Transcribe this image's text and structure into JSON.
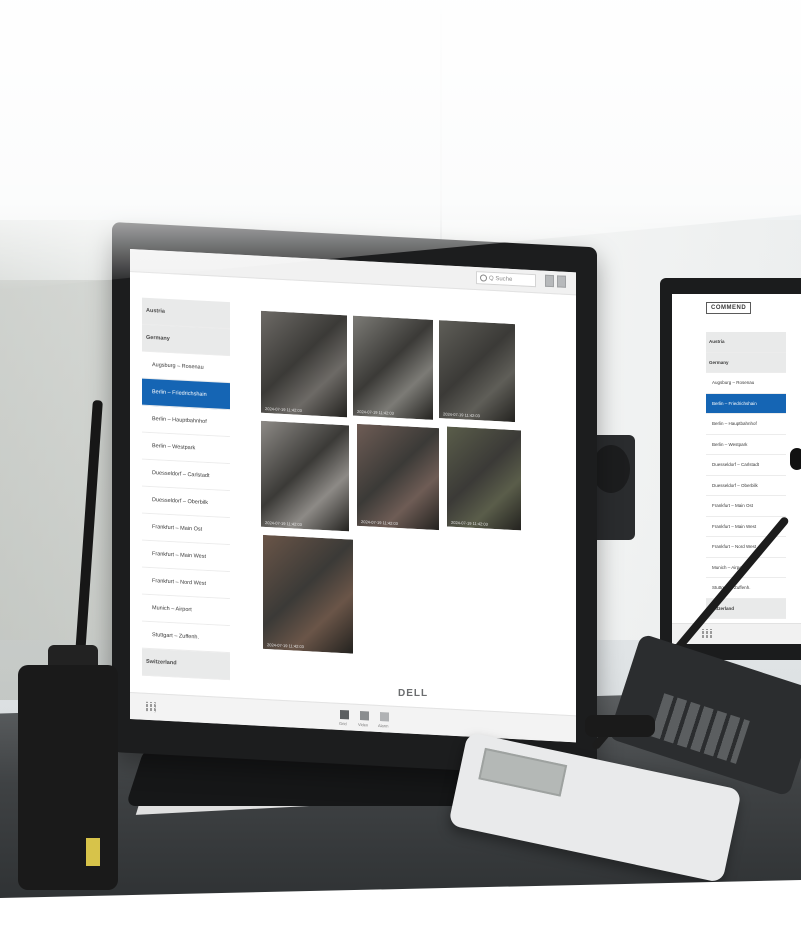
{
  "main_monitor": {
    "brand": "DELL",
    "search_placeholder": "Q Suche",
    "sidebar": [
      {
        "label": "Austria",
        "type": "country"
      },
      {
        "label": "Germany",
        "type": "country"
      },
      {
        "label": "Augsburg – Rosenau",
        "type": "item"
      },
      {
        "label": "Berlin – Friedrichshain",
        "type": "item",
        "active": true
      },
      {
        "label": "Berlin – Hauptbahnhof",
        "type": "item"
      },
      {
        "label": "Berlin – Westpark",
        "type": "item"
      },
      {
        "label": "Duesseldorf – Carlstadt",
        "type": "item"
      },
      {
        "label": "Duesseldorf – Oberbilk",
        "type": "item"
      },
      {
        "label": "Frankfurt – Main Ost",
        "type": "item"
      },
      {
        "label": "Frankfurt – Main West",
        "type": "item"
      },
      {
        "label": "Frankfurt – Nord West",
        "type": "item"
      },
      {
        "label": "Munich – Airport",
        "type": "item"
      },
      {
        "label": "Stuttgart – Zuffenh.",
        "type": "item"
      },
      {
        "label": "Switzerland",
        "type": "country"
      }
    ],
    "cameras": [
      {
        "timestamp": "2024-07-19 11:42:03",
        "palette": "#6d6a66"
      },
      {
        "timestamp": "2024-07-19 11:42:03",
        "palette": "#7c7b76"
      },
      {
        "timestamp": "2024-07-19 11:42:03",
        "palette": "#5f5e58"
      },
      {
        "timestamp": "2024-07-19 11:42:03",
        "palette": "#8d8a86"
      },
      {
        "timestamp": "2024-07-19 11:42:03",
        "palette": "#6e5c55"
      },
      {
        "timestamp": "2024-07-19 11:42:03",
        "palette": "#5a5d4a"
      },
      {
        "timestamp": "2024-07-19 11:42:03",
        "palette": "#6a5548"
      }
    ],
    "bottom_buttons": [
      "Grid",
      "Video",
      "Alarm"
    ]
  },
  "secondary_monitor": {
    "logo": "COMMEND",
    "sidebar": [
      {
        "label": "Austria",
        "type": "country"
      },
      {
        "label": "Germany",
        "type": "country"
      },
      {
        "label": "Augsburg – Rosenau",
        "type": "item"
      },
      {
        "label": "Berlin – Friedrichshain",
        "type": "item",
        "active": true
      },
      {
        "label": "Berlin – Hauptbahnhof",
        "type": "item"
      },
      {
        "label": "Berlin – Westpark",
        "type": "item"
      },
      {
        "label": "Duesseldorf – Carlstadt",
        "type": "item"
      },
      {
        "label": "Duesseldorf – Oberbilk",
        "type": "item"
      },
      {
        "label": "Frankfurt – Main Ost",
        "type": "item"
      },
      {
        "label": "Frankfurt – Main West",
        "type": "item"
      },
      {
        "label": "Frankfurt – Nord West",
        "type": "item"
      },
      {
        "label": "Munich – Airport",
        "type": "item"
      },
      {
        "label": "Stuttgart – Zuffenh.",
        "type": "item"
      },
      {
        "label": "Switzerland",
        "type": "country"
      }
    ]
  },
  "colors": {
    "accent": "#1565b4",
    "sidebar_country_bg": "#e9eaea"
  }
}
